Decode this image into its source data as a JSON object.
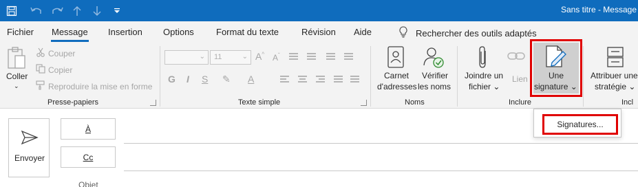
{
  "window": {
    "title": "Sans titre  -  Message",
    "quick_access": [
      "save-icon",
      "undo-icon",
      "redo-icon",
      "up-arrow-icon",
      "down-arrow-icon",
      "customize-qat-icon"
    ]
  },
  "menu": {
    "tabs": [
      "Fichier",
      "Message",
      "Insertion",
      "Options",
      "Format du texte",
      "Révision",
      "Aide"
    ],
    "active": "Message",
    "search_hint": "Rechercher des outils adaptés"
  },
  "ribbon": {
    "clipboard": {
      "paste_label": "Coller",
      "cut_label": "Couper",
      "copy_label": "Copier",
      "format_painter_label": "Reproduire la mise en forme",
      "group_label": "Presse-papiers"
    },
    "basic_text": {
      "font_name": "",
      "font_size": "11",
      "group_label": "Texte simple"
    },
    "names": {
      "address_book_line1": "Carnet",
      "address_book_line2": "d'adresses",
      "check_names_line1": "Vérifier",
      "check_names_line2": "les noms",
      "group_label": "Noms"
    },
    "include": {
      "attach_line1": "Joindre un",
      "attach_line2": "fichier",
      "link_label": "Lien",
      "signature_line1": "Une",
      "signature_line2": "signature",
      "group_label": "Inclure"
    },
    "policy": {
      "line1": "Attribuer une",
      "line2": "stratégie",
      "group_label": "Incl"
    }
  },
  "signature_menu": {
    "items": [
      "Signatures..."
    ]
  },
  "compose": {
    "send_label": "Envoyer",
    "to_label": "À",
    "cc_label": "Cc",
    "subject_label": "Objet"
  },
  "colors": {
    "title_bar": "#0f6cbd",
    "highlight": "#e00000"
  }
}
